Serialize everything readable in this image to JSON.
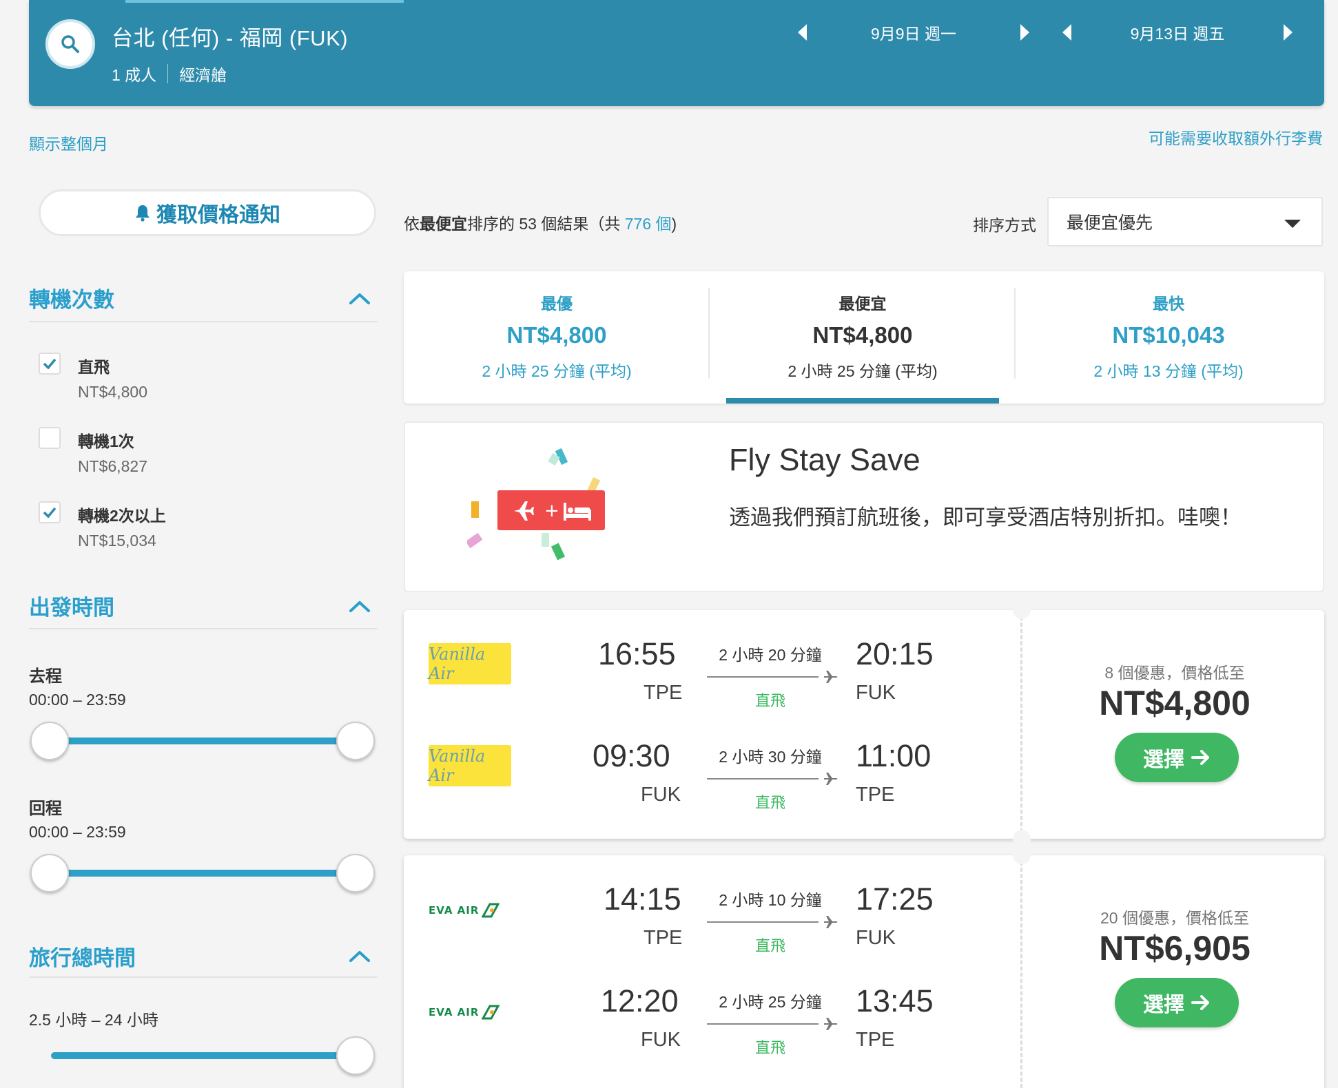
{
  "header": {
    "route": "台北 (任何) - 福岡 (FUK)",
    "passengers": "1 成人",
    "cabin": "經濟艙",
    "depart_date": "9月9日 週一",
    "return_date": "9月13日 週五"
  },
  "links": {
    "show_month": "顯示整個月",
    "baggage_fee": "可能需要收取額外行李費"
  },
  "sidebar": {
    "price_alert": "獲取價格通知",
    "stops": {
      "title": "轉機次數",
      "options": [
        {
          "label": "直飛",
          "price": "NT$4,800",
          "checked": true
        },
        {
          "label": "轉機1次",
          "price": "NT$6,827",
          "checked": false
        },
        {
          "label": "轉機2次以上",
          "price": "NT$15,034",
          "checked": true
        }
      ]
    },
    "departure_time": {
      "title": "出發時間",
      "outbound_label": "去程",
      "outbound_range": "00:00 – 23:59",
      "return_label": "回程",
      "return_range": "00:00 – 23:59"
    },
    "duration": {
      "title": "旅行總時間",
      "range": "2.5 小時 – 24 小時"
    }
  },
  "results": {
    "prefix": "依",
    "sort_word": "最便宜",
    "middle": "排序的 53 個結果（共 ",
    "total": "776 個",
    "suffix": ")",
    "sort_label": "排序方式",
    "sort_value": "最便宜優先"
  },
  "tabs": [
    {
      "label": "最優",
      "price": "NT$4,800",
      "duration": "2 小時 25 分鐘 (平均)"
    },
    {
      "label": "最便宜",
      "price": "NT$4,800",
      "duration": "2 小時 25 分鐘 (平均)"
    },
    {
      "label": "最快",
      "price": "NT$10,043",
      "duration": "2 小時 13 分鐘 (平均)"
    }
  ],
  "promo": {
    "title": "Fly Stay Save",
    "text": "透過我們預訂航班後，即可享受酒店特別折扣。哇噢！"
  },
  "flights": [
    {
      "airline": "Vanilla Air",
      "legs": [
        {
          "dep_time": "16:55",
          "dep_code": "TPE",
          "duration": "2 小時 20 分鐘",
          "stops": "直飛",
          "arr_time": "20:15",
          "arr_code": "FUK"
        },
        {
          "dep_time": "09:30",
          "dep_code": "FUK",
          "duration": "2 小時 30 分鐘",
          "stops": "直飛",
          "arr_time": "11:00",
          "arr_code": "TPE"
        }
      ],
      "deals": "8 個優惠，價格低至",
      "price": "NT$4,800",
      "select": "選擇"
    },
    {
      "airline": "EVA AIR",
      "legs": [
        {
          "dep_time": "14:15",
          "dep_code": "TPE",
          "duration": "2 小時 10 分鐘",
          "stops": "直飛",
          "arr_time": "17:25",
          "arr_code": "FUK"
        },
        {
          "dep_time": "12:20",
          "dep_code": "FUK",
          "duration": "2 小時 25 分鐘",
          "stops": "直飛",
          "arr_time": "13:45",
          "arr_code": "TPE"
        }
      ],
      "deals": "20 個優惠，價格低至",
      "price": "NT$6,905",
      "select": "選擇"
    }
  ],
  "colors": {
    "header": "#2e8aaa",
    "accent": "#2e9fc6",
    "green": "#3fb763"
  }
}
